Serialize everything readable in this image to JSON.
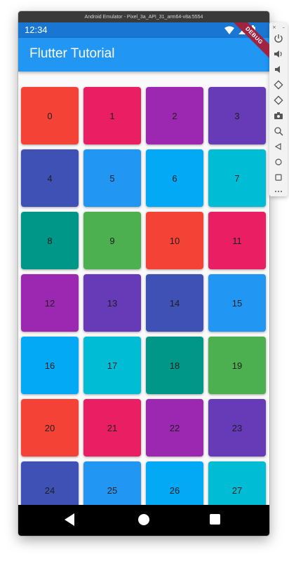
{
  "emulator": {
    "title": "Android Emulator - Pixel_3a_API_31_arm64-v8a:5554",
    "toolbar": {
      "close_label": "×",
      "minimize_label": "–",
      "buttons": [
        "power-icon",
        "volume-up-icon",
        "volume-down-icon",
        "rotate-left-icon",
        "rotate-right-icon",
        "camera-icon",
        "zoom-icon",
        "back-icon",
        "home-icon",
        "overview-icon",
        "more-icon"
      ]
    }
  },
  "status_bar": {
    "time": "12:34"
  },
  "app_bar": {
    "title": "Flutter Tutorial"
  },
  "debug_banner": "DEBUG",
  "colors": {
    "status_bar": "#1976D2",
    "app_bar": "#2196F3",
    "palette": [
      "#F44336",
      "#E91E63",
      "#9C27B0",
      "#673AB7",
      "#3F51B5",
      "#2196F3",
      "#03A9F4",
      "#00BCD4",
      "#009688",
      "#4CAF50"
    ]
  },
  "grid": {
    "columns": 4,
    "tiles": [
      {
        "label": "0",
        "color": "#F44336"
      },
      {
        "label": "1",
        "color": "#E91E63"
      },
      {
        "label": "2",
        "color": "#9C27B0"
      },
      {
        "label": "3",
        "color": "#673AB7"
      },
      {
        "label": "4",
        "color": "#3F51B5"
      },
      {
        "label": "5",
        "color": "#2196F3"
      },
      {
        "label": "6",
        "color": "#03A9F4"
      },
      {
        "label": "7",
        "color": "#00BCD4"
      },
      {
        "label": "8",
        "color": "#009688"
      },
      {
        "label": "9",
        "color": "#4CAF50"
      },
      {
        "label": "10",
        "color": "#F44336"
      },
      {
        "label": "11",
        "color": "#E91E63"
      },
      {
        "label": "12",
        "color": "#9C27B0"
      },
      {
        "label": "13",
        "color": "#673AB7"
      },
      {
        "label": "14",
        "color": "#3F51B5"
      },
      {
        "label": "15",
        "color": "#2196F3"
      },
      {
        "label": "16",
        "color": "#03A9F4"
      },
      {
        "label": "17",
        "color": "#00BCD4"
      },
      {
        "label": "18",
        "color": "#009688"
      },
      {
        "label": "19",
        "color": "#4CAF50"
      },
      {
        "label": "20",
        "color": "#F44336"
      },
      {
        "label": "21",
        "color": "#E91E63"
      },
      {
        "label": "22",
        "color": "#9C27B0"
      },
      {
        "label": "23",
        "color": "#673AB7"
      },
      {
        "label": "24",
        "color": "#3F51B5"
      },
      {
        "label": "25",
        "color": "#2196F3"
      },
      {
        "label": "26",
        "color": "#03A9F4"
      },
      {
        "label": "27",
        "color": "#00BCD4"
      }
    ]
  },
  "nav_bar": {
    "buttons": [
      "back-icon",
      "home-icon",
      "overview-icon"
    ]
  }
}
